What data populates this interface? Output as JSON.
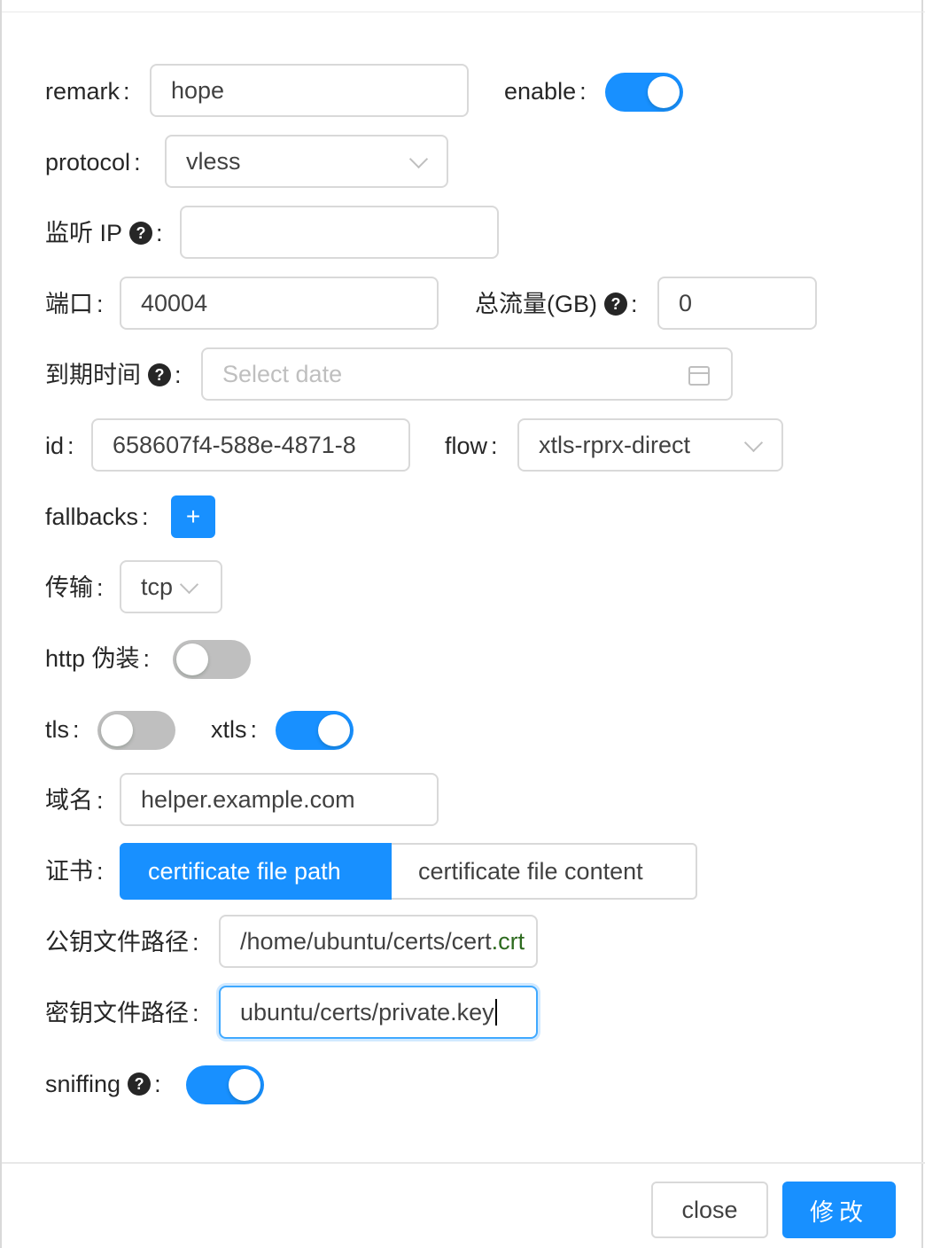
{
  "form": {
    "remark": {
      "label": "remark",
      "value": "hope"
    },
    "enable": {
      "label": "enable",
      "on": true
    },
    "protocol": {
      "label": "protocol",
      "value": "vless"
    },
    "listen_ip": {
      "label": "监听 IP",
      "value": ""
    },
    "port": {
      "label": "端口",
      "value": "40004"
    },
    "total_traffic": {
      "label": "总流量(GB)",
      "value": "0"
    },
    "expiry": {
      "label": "到期时间",
      "placeholder": "Select date"
    },
    "id": {
      "label": "id",
      "value": "658607f4-588e-4871-8"
    },
    "flow": {
      "label": "flow",
      "value": "xtls-rprx-direct"
    },
    "fallbacks": {
      "label": "fallbacks",
      "add_label": "+"
    },
    "transport": {
      "label": "传输",
      "value": "tcp"
    },
    "http_camouflage": {
      "label": "http 伪装",
      "on": false
    },
    "tls": {
      "label": "tls",
      "on": false
    },
    "xtls": {
      "label": "xtls",
      "on": true
    },
    "domain": {
      "label": "域名",
      "value": "helper.example.com"
    },
    "certificate": {
      "label": "证书",
      "options": [
        "certificate file path",
        "certificate file content"
      ],
      "selected": "certificate file path"
    },
    "public_key_path": {
      "label": "公钥文件路径",
      "value_main": "/home/ubuntu/certs/cert",
      "value_tail": ".crt"
    },
    "private_key_path": {
      "label": "密钥文件路径",
      "value": "ubuntu/certs/private.key"
    },
    "sniffing": {
      "label": "sniffing",
      "on": true
    }
  },
  "footer": {
    "close_label": "close",
    "submit_label": "修改"
  },
  "colors": {
    "primary": "#1890ff",
    "switch_off": "#bfbfbf",
    "border": "#d9d9d9"
  }
}
